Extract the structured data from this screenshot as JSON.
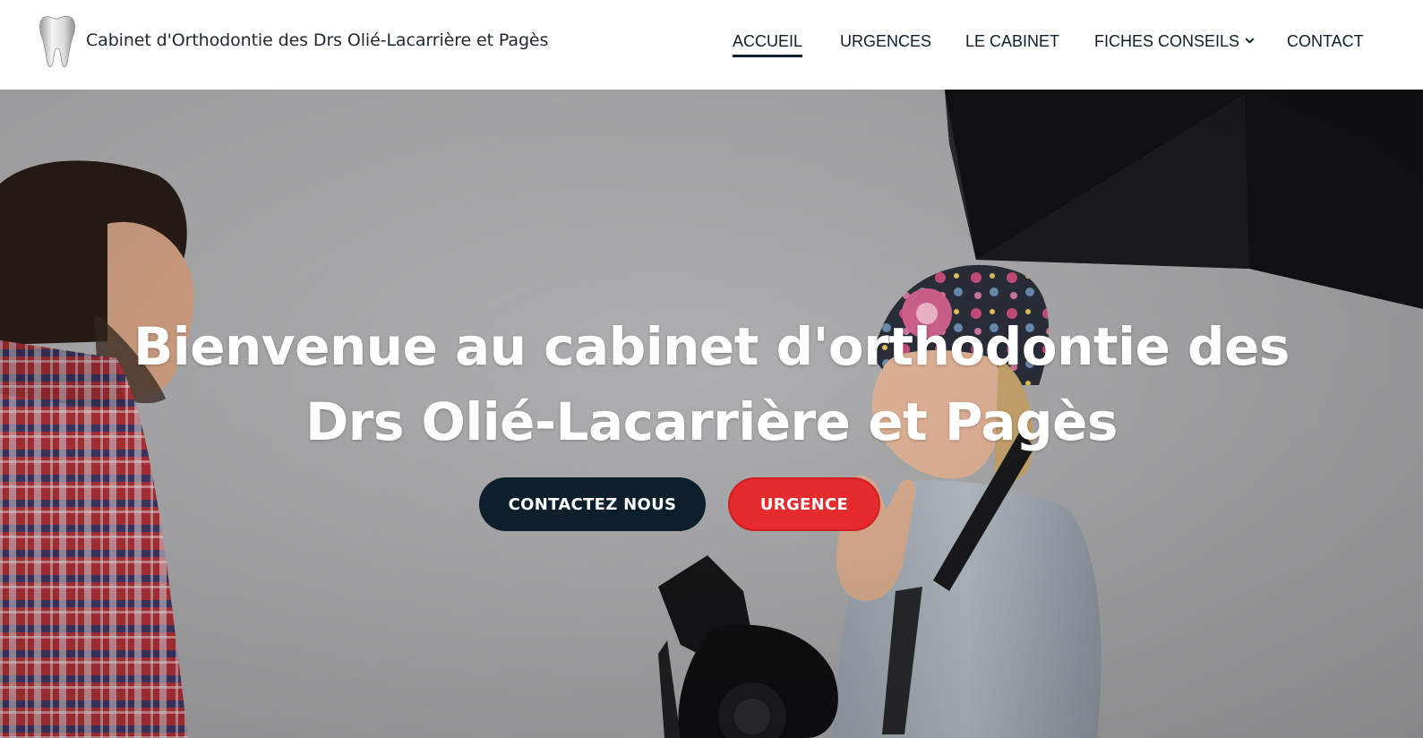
{
  "header": {
    "site_name": "Cabinet d'Orthodontie des Drs Olié-Lacarrière et Pagès",
    "logo_icon": "tooth-icon",
    "nav": [
      {
        "label": "ACCUEIL",
        "active": true
      },
      {
        "label": "URGENCES",
        "active": false
      },
      {
        "label": "LE CABINET",
        "active": false
      },
      {
        "label": "FICHES CONSEILS",
        "active": false,
        "has_dropdown": true,
        "icon": "chevron-down-icon"
      },
      {
        "label": "CONTACT",
        "active": false
      }
    ]
  },
  "hero": {
    "title_line1": "Bienvenue au cabinet d'orthodontie des",
    "title_line2": "Drs Olié-Lacarrière et Pagès",
    "buttons": {
      "contact_label": "CONTACTEZ NOUS",
      "urgence_label": "URGENCE"
    }
  },
  "colors": {
    "nav_text": "#0e1e2b",
    "contact_button": "#0c1f2c",
    "urgence_button": "#e52b2d",
    "hero_text": "#ffffff"
  }
}
